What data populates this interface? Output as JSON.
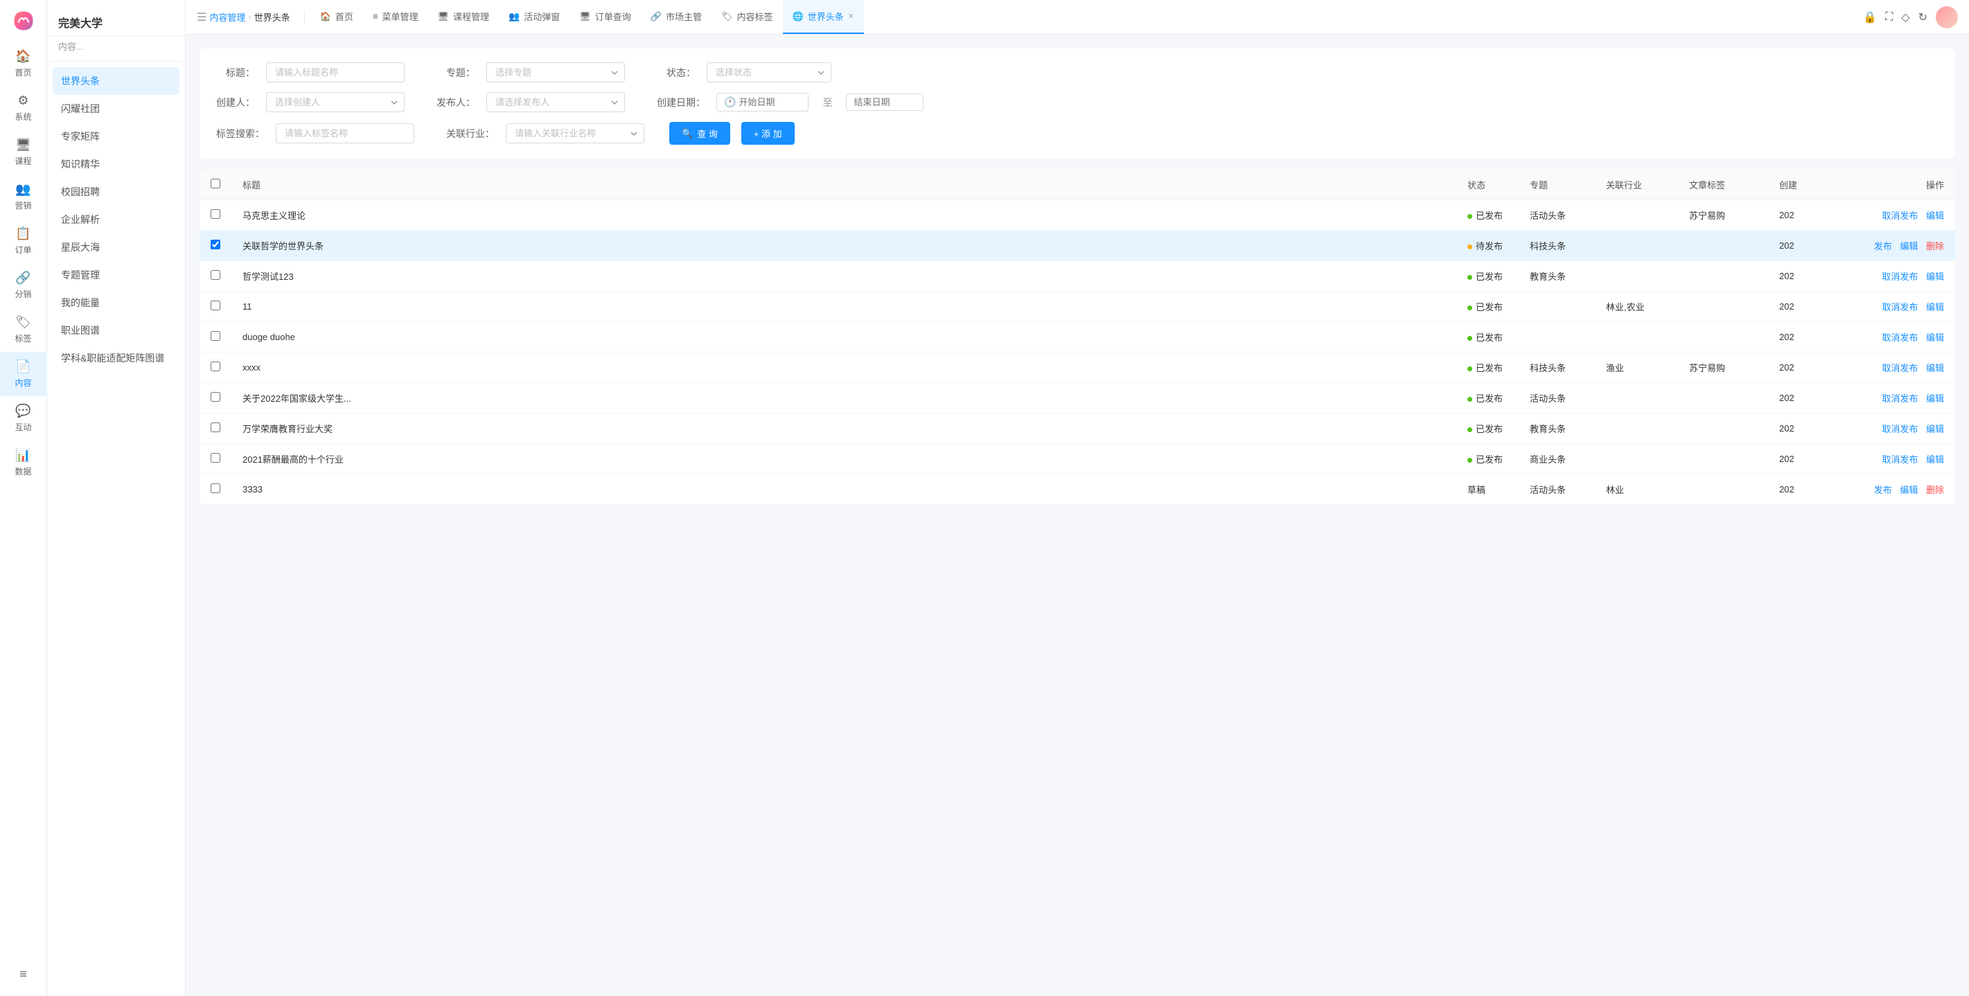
{
  "app": {
    "name": "完美大学",
    "sub": "内容..."
  },
  "sidebar": {
    "items": [
      {
        "id": "home",
        "label": "首页",
        "icon": "🏠"
      },
      {
        "id": "system",
        "label": "系统",
        "icon": "⚙"
      },
      {
        "id": "course",
        "label": "课程",
        "icon": "🖥"
      },
      {
        "id": "marketing",
        "label": "营销",
        "icon": "👥"
      },
      {
        "id": "order",
        "label": "订单",
        "icon": "📋"
      },
      {
        "id": "distribute",
        "label": "分销",
        "icon": "🔗"
      },
      {
        "id": "tag",
        "label": "标签",
        "icon": "🏷"
      },
      {
        "id": "content",
        "label": "内容",
        "icon": "📄",
        "active": true
      },
      {
        "id": "interact",
        "label": "互动",
        "icon": "💬"
      },
      {
        "id": "data",
        "label": "数据",
        "icon": "📊"
      }
    ]
  },
  "secondary_sidebar": {
    "title": "完美大学",
    "sub": "内容...",
    "items": [
      {
        "id": "world-headline",
        "label": "世界头条",
        "active": true
      },
      {
        "id": "flash-community",
        "label": "闪耀社团"
      },
      {
        "id": "expert-matrix",
        "label": "专家矩阵"
      },
      {
        "id": "knowledge-essence",
        "label": "知识精华"
      },
      {
        "id": "campus-recruit",
        "label": "校园招聘"
      },
      {
        "id": "enterprise-analysis",
        "label": "企业解析"
      },
      {
        "id": "star-ocean",
        "label": "星辰大海"
      },
      {
        "id": "topic-management",
        "label": "专题管理"
      },
      {
        "id": "my-energy",
        "label": "我的能量"
      },
      {
        "id": "career-map",
        "label": "职业图谱"
      },
      {
        "id": "subject-matrix",
        "label": "学科&职能适配矩阵图谱"
      }
    ]
  },
  "breadcrumb": {
    "parent": "内容管理",
    "separator": "›",
    "current": "世界头条"
  },
  "tabs": [
    {
      "id": "home",
      "label": "首页",
      "icon": "🏠",
      "active": false,
      "closable": false
    },
    {
      "id": "menu",
      "label": "菜单管理",
      "icon": "≡",
      "active": false,
      "closable": false
    },
    {
      "id": "course",
      "label": "课程管理",
      "icon": "🖥",
      "active": false,
      "closable": false
    },
    {
      "id": "activity",
      "label": "活动弹窗",
      "icon": "👥",
      "active": false,
      "closable": false
    },
    {
      "id": "order-query",
      "label": "订单查询",
      "icon": "🖥",
      "active": false,
      "closable": false
    },
    {
      "id": "market-admin",
      "label": "市场主管",
      "icon": "🔗",
      "active": false,
      "closable": false
    },
    {
      "id": "content-tag",
      "label": "内容标签",
      "icon": "🏷",
      "active": false,
      "closable": false
    },
    {
      "id": "world-headline",
      "label": "世界头条",
      "icon": "🌐",
      "active": true,
      "closable": true
    }
  ],
  "filters": {
    "title_label": "标题：",
    "title_placeholder": "请输入标题名称",
    "topic_label": "专题：",
    "topic_placeholder": "选择专题",
    "status_label": "状态：",
    "status_placeholder": "选择状态",
    "creator_label": "创建人：",
    "creator_placeholder": "选择创建人",
    "publisher_label": "发布人：",
    "publisher_placeholder": "请选择发布人",
    "create_date_label": "创建日期：",
    "start_date_placeholder": "开始日期",
    "end_date_placeholder": "结束日期",
    "tag_label": "标签搜索：",
    "tag_placeholder": "请输入标签名称",
    "industry_label": "关联行业：",
    "industry_placeholder": "请输入关联行业名称",
    "query_btn": "查 询",
    "add_btn": "+ 添 加"
  },
  "table": {
    "columns": [
      {
        "id": "checkbox",
        "label": ""
      },
      {
        "id": "title",
        "label": "标题"
      },
      {
        "id": "status",
        "label": "状态"
      },
      {
        "id": "topic",
        "label": "专题"
      },
      {
        "id": "industry",
        "label": "关联行业"
      },
      {
        "id": "tag",
        "label": "文章标签"
      },
      {
        "id": "create",
        "label": "创建"
      },
      {
        "id": "action",
        "label": "操作"
      }
    ],
    "rows": [
      {
        "id": 1,
        "title": "马克思主义理论",
        "status": "已发布",
        "status_type": "published",
        "topic": "活动头条",
        "industry": "",
        "tag": "苏宁易购",
        "create": "202",
        "actions": [
          "取消发布",
          "编辑"
        ]
      },
      {
        "id": 2,
        "title": "关联哲学的世界头条",
        "status": "待发布",
        "status_type": "pending",
        "topic": "科技头条",
        "industry": "",
        "tag": "",
        "create": "202",
        "actions": [
          "发布",
          "编辑",
          "删除"
        ],
        "selected": true
      },
      {
        "id": 3,
        "title": "哲学测试123",
        "status": "已发布",
        "status_type": "published",
        "topic": "教育头条",
        "industry": "",
        "tag": "",
        "create": "202",
        "actions": [
          "取消发布",
          "编辑"
        ]
      },
      {
        "id": 4,
        "title": "11",
        "status": "已发布",
        "status_type": "published",
        "topic": "",
        "industry": "林业,农业",
        "tag": "",
        "create": "202",
        "actions": [
          "取消发布",
          "编辑"
        ]
      },
      {
        "id": 5,
        "title": "duoge duohe",
        "status": "已发布",
        "status_type": "published",
        "topic": "",
        "industry": "",
        "tag": "",
        "create": "202",
        "actions": [
          "取消发布",
          "编辑"
        ]
      },
      {
        "id": 6,
        "title": "xxxx",
        "status": "已发布",
        "status_type": "published",
        "topic": "科技头条",
        "industry": "渔业",
        "tag": "苏宁易购",
        "create": "202",
        "actions": [
          "取消发布",
          "编辑"
        ]
      },
      {
        "id": 7,
        "title": "关于2022年国家级大学生...",
        "status": "已发布",
        "status_type": "published",
        "topic": "活动头条",
        "industry": "",
        "tag": "",
        "create": "202",
        "actions": [
          "取消发布",
          "编辑"
        ]
      },
      {
        "id": 8,
        "title": "万学荣膺教育行业大奖",
        "status": "已发布",
        "status_type": "published",
        "topic": "教育头条",
        "industry": "",
        "tag": "",
        "create": "202",
        "actions": [
          "取消发布",
          "编辑"
        ]
      },
      {
        "id": 9,
        "title": "2021薪酬最高的十个行业",
        "status": "已发布",
        "status_type": "published",
        "topic": "商业头条",
        "industry": "",
        "tag": "",
        "create": "202",
        "actions": [
          "取消发布",
          "编辑"
        ]
      },
      {
        "id": 10,
        "title": "3333",
        "status": "草稿",
        "status_type": "draft",
        "topic": "活动头条",
        "industry": "林业",
        "tag": "",
        "create": "202",
        "actions": [
          "发布",
          "编辑",
          "删除"
        ]
      }
    ]
  },
  "top_right": {
    "lock_icon": "🔒",
    "expand_icon": "⛶",
    "diamond_icon": "◇",
    "refresh_icon": "↻"
  }
}
